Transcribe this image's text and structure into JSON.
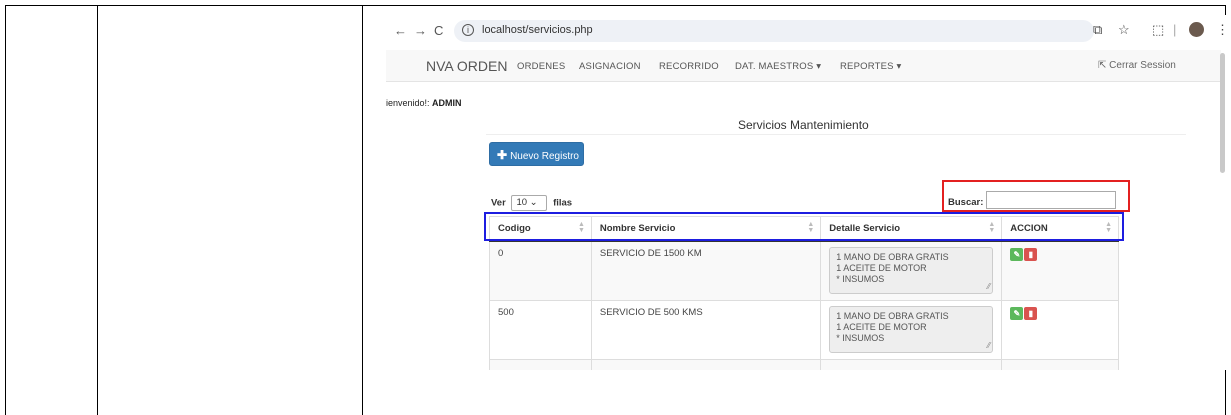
{
  "browser": {
    "url": "localhost/servicios.php",
    "back_icon": "←",
    "forward_icon": "→",
    "reload_icon": "C",
    "info_icon": "i"
  },
  "navbar": {
    "brand": "NVA ORDEN",
    "items": [
      {
        "label": "ORDENES"
      },
      {
        "label": "ASIGNACION"
      },
      {
        "label": "RECORRIDO"
      },
      {
        "label": "DAT. MAESTROS ▾"
      },
      {
        "label": "REPORTES ▾"
      }
    ],
    "logout": "Cerrar Session"
  },
  "welcome": {
    "prefix": "ienvenido!: ",
    "user": "ADMIN"
  },
  "page": {
    "title": "Servicios Mantenimiento",
    "new_button": "Nuevo Registro"
  },
  "list": {
    "show_prefix": "Ver",
    "page_length": "10",
    "show_suffix": "filas",
    "search_label": "Buscar:",
    "search_value": ""
  },
  "table": {
    "headers": [
      "Codigo",
      "Nombre Servicio",
      "Detalle Servicio",
      "ACCION"
    ],
    "rows": [
      {
        "codigo": "0",
        "nombre": "SERVICIO DE 1500 KM",
        "detalle": [
          "1 MANO DE OBRA GRATIS",
          "1 ACEITE DE MOTOR",
          "* INSUMOS"
        ]
      },
      {
        "codigo": "500",
        "nombre": "SERVICIO DE 500 KMS",
        "detalle": [
          "1 MANO DE OBRA GRATIS",
          "1 ACEITE DE MOTOR",
          "* INSUMOS"
        ]
      }
    ]
  },
  "colors": {
    "primary_button": "#337ab7",
    "edit_button": "#5cb85c",
    "delete_button": "#d9534f",
    "highlight_red": "#e32020",
    "highlight_blue": "#1d1de0"
  }
}
